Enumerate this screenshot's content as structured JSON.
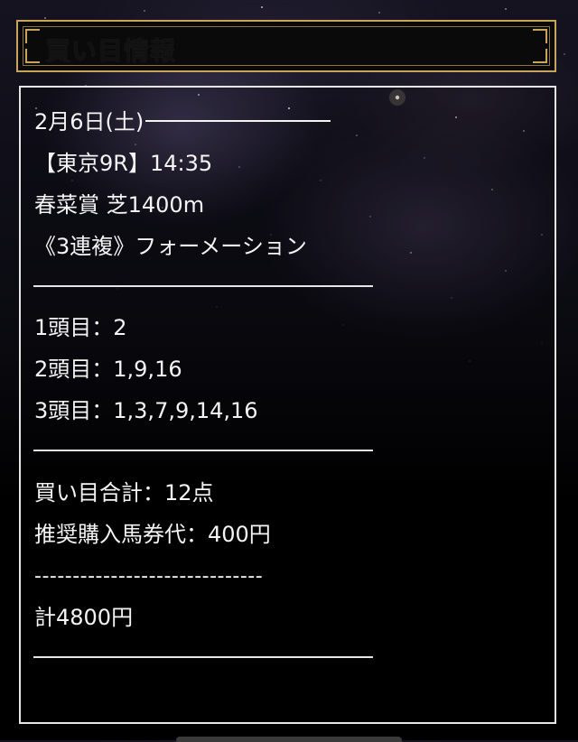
{
  "header": {
    "title": "買い目情報"
  },
  "race": {
    "date": "2月6日(土)",
    "venue_time": "【東京9R】14:35",
    "race_name": "春菜賞 芝1400m",
    "bet_type": "《3連複》フォーメーション"
  },
  "selections": {
    "first": "1頭目：2",
    "second": "2頭目：1,9,16",
    "third": "3頭目：1,3,7,9,14,16"
  },
  "summary": {
    "total_bets": "買い目合計：12点",
    "unit_price": "推奨購入馬券代：400円",
    "dashes": "------------------------------",
    "total_amount": "計4800円"
  },
  "colors": {
    "frame_gold": "#c9a45a",
    "box_border": "#e6e6e6",
    "text": "#f4f4f4",
    "background": "#000000"
  }
}
